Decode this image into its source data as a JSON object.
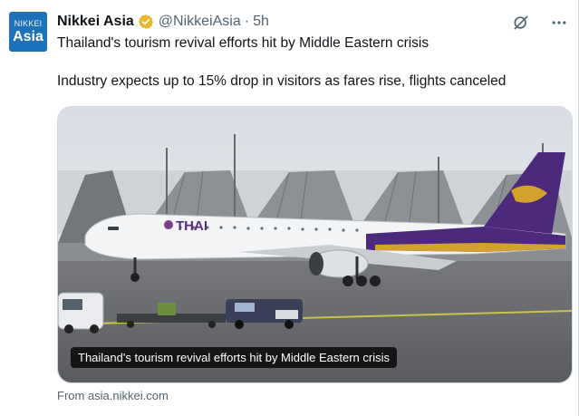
{
  "avatar": {
    "line1": "NIKKEI",
    "line2": "Asia"
  },
  "author": {
    "name": "Nikkei Asia",
    "handle": "@NikkeiAsia",
    "separator": "·",
    "time": "5h"
  },
  "tweet": {
    "headline": "Thailand's tourism revival efforts hit by Middle Eastern crisis",
    "subhead": "Industry expects up to 15% drop in visitors as fares rise, flights canceled"
  },
  "card": {
    "image_desc_icon": "airplane-photo",
    "aircraft_livery": "THAI",
    "caption": "Thailand's tourism revival efforts hit by Middle Eastern crisis",
    "source": "From asia.nikkei.com"
  },
  "icons": {
    "verified": "verified-badge-icon",
    "grok": "grok-icon",
    "more": "more-icon"
  },
  "colors": {
    "brand_blue": "#1d71b8",
    "badge_gold": "#e8b829",
    "thai_purple": "#4b2a7b"
  }
}
